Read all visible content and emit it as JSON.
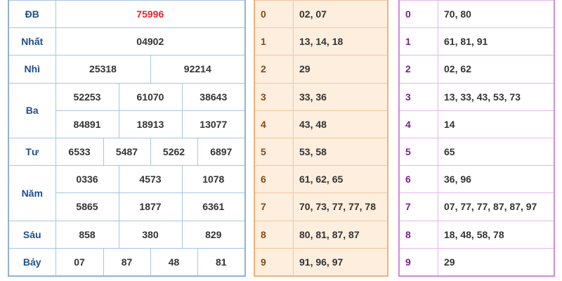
{
  "results": {
    "db": {
      "label": "ĐB",
      "value": "75996"
    },
    "nhat": {
      "label": "Nhất",
      "value": "04902"
    },
    "nhi": {
      "label": "Nhì",
      "values": [
        "25318",
        "92214"
      ]
    },
    "ba": {
      "label": "Ba",
      "values": [
        "52253",
        "61070",
        "38643",
        "84891",
        "18913",
        "13077"
      ]
    },
    "tu": {
      "label": "Tư",
      "values": [
        "6533",
        "5487",
        "5262",
        "6897"
      ]
    },
    "nam": {
      "label": "Năm",
      "values": [
        "0336",
        "4573",
        "1078",
        "5865",
        "1877",
        "6361"
      ]
    },
    "sau": {
      "label": "Sáu",
      "values": [
        "858",
        "380",
        "829"
      ]
    },
    "bay": {
      "label": "Bảy",
      "values": [
        "07",
        "87",
        "48",
        "81"
      ]
    }
  },
  "heads": [
    {
      "key": "0",
      "values": "02, 07"
    },
    {
      "key": "1",
      "values": "13, 14, 18"
    },
    {
      "key": "2",
      "values": "29"
    },
    {
      "key": "3",
      "values": "33, 36"
    },
    {
      "key": "4",
      "values": "43, 48"
    },
    {
      "key": "5",
      "values": "53, 58"
    },
    {
      "key": "6",
      "values": "61, 62, 65"
    },
    {
      "key": "7",
      "values": "70, 73, 77, 77, 78"
    },
    {
      "key": "8",
      "values": "80, 81, 87, 87"
    },
    {
      "key": "9",
      "values": "91, 96, 97"
    }
  ],
  "tails": [
    {
      "key": "0",
      "values": "70, 80"
    },
    {
      "key": "1",
      "values": "61, 81, 91"
    },
    {
      "key": "2",
      "values": "02, 62"
    },
    {
      "key": "3",
      "values": "13, 33, 43, 53, 73"
    },
    {
      "key": "4",
      "values": "14"
    },
    {
      "key": "5",
      "values": "65"
    },
    {
      "key": "6",
      "values": "36, 96"
    },
    {
      "key": "7",
      "values": "07, 77, 77, 87, 87, 97"
    },
    {
      "key": "8",
      "values": "18, 48, 58, 78"
    },
    {
      "key": "9",
      "values": "29"
    }
  ]
}
